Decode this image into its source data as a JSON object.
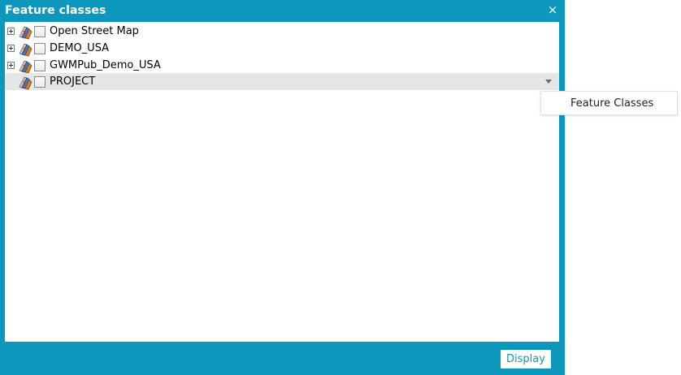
{
  "dialog": {
    "title": "Feature classes",
    "close_symbol": "×",
    "accent_color": "#0d97bd"
  },
  "tree": {
    "items": [
      {
        "label": "Open Street Map",
        "expandable": true,
        "checked": false,
        "icon": "layer-stack-icon"
      },
      {
        "label": "DEMO_USA",
        "expandable": true,
        "checked": false,
        "icon": "layer-stack-icon"
      },
      {
        "label": "GWMPub_Demo_USA",
        "expandable": true,
        "checked": false,
        "icon": "layer-stack-icon"
      },
      {
        "label": "PROJECT",
        "expandable": false,
        "checked": false,
        "selected": true,
        "icon": "layer-stack-icon"
      }
    ]
  },
  "context_menu": {
    "items": [
      {
        "label": "Feature Classes"
      }
    ]
  },
  "footer": {
    "display_label": "Display"
  }
}
